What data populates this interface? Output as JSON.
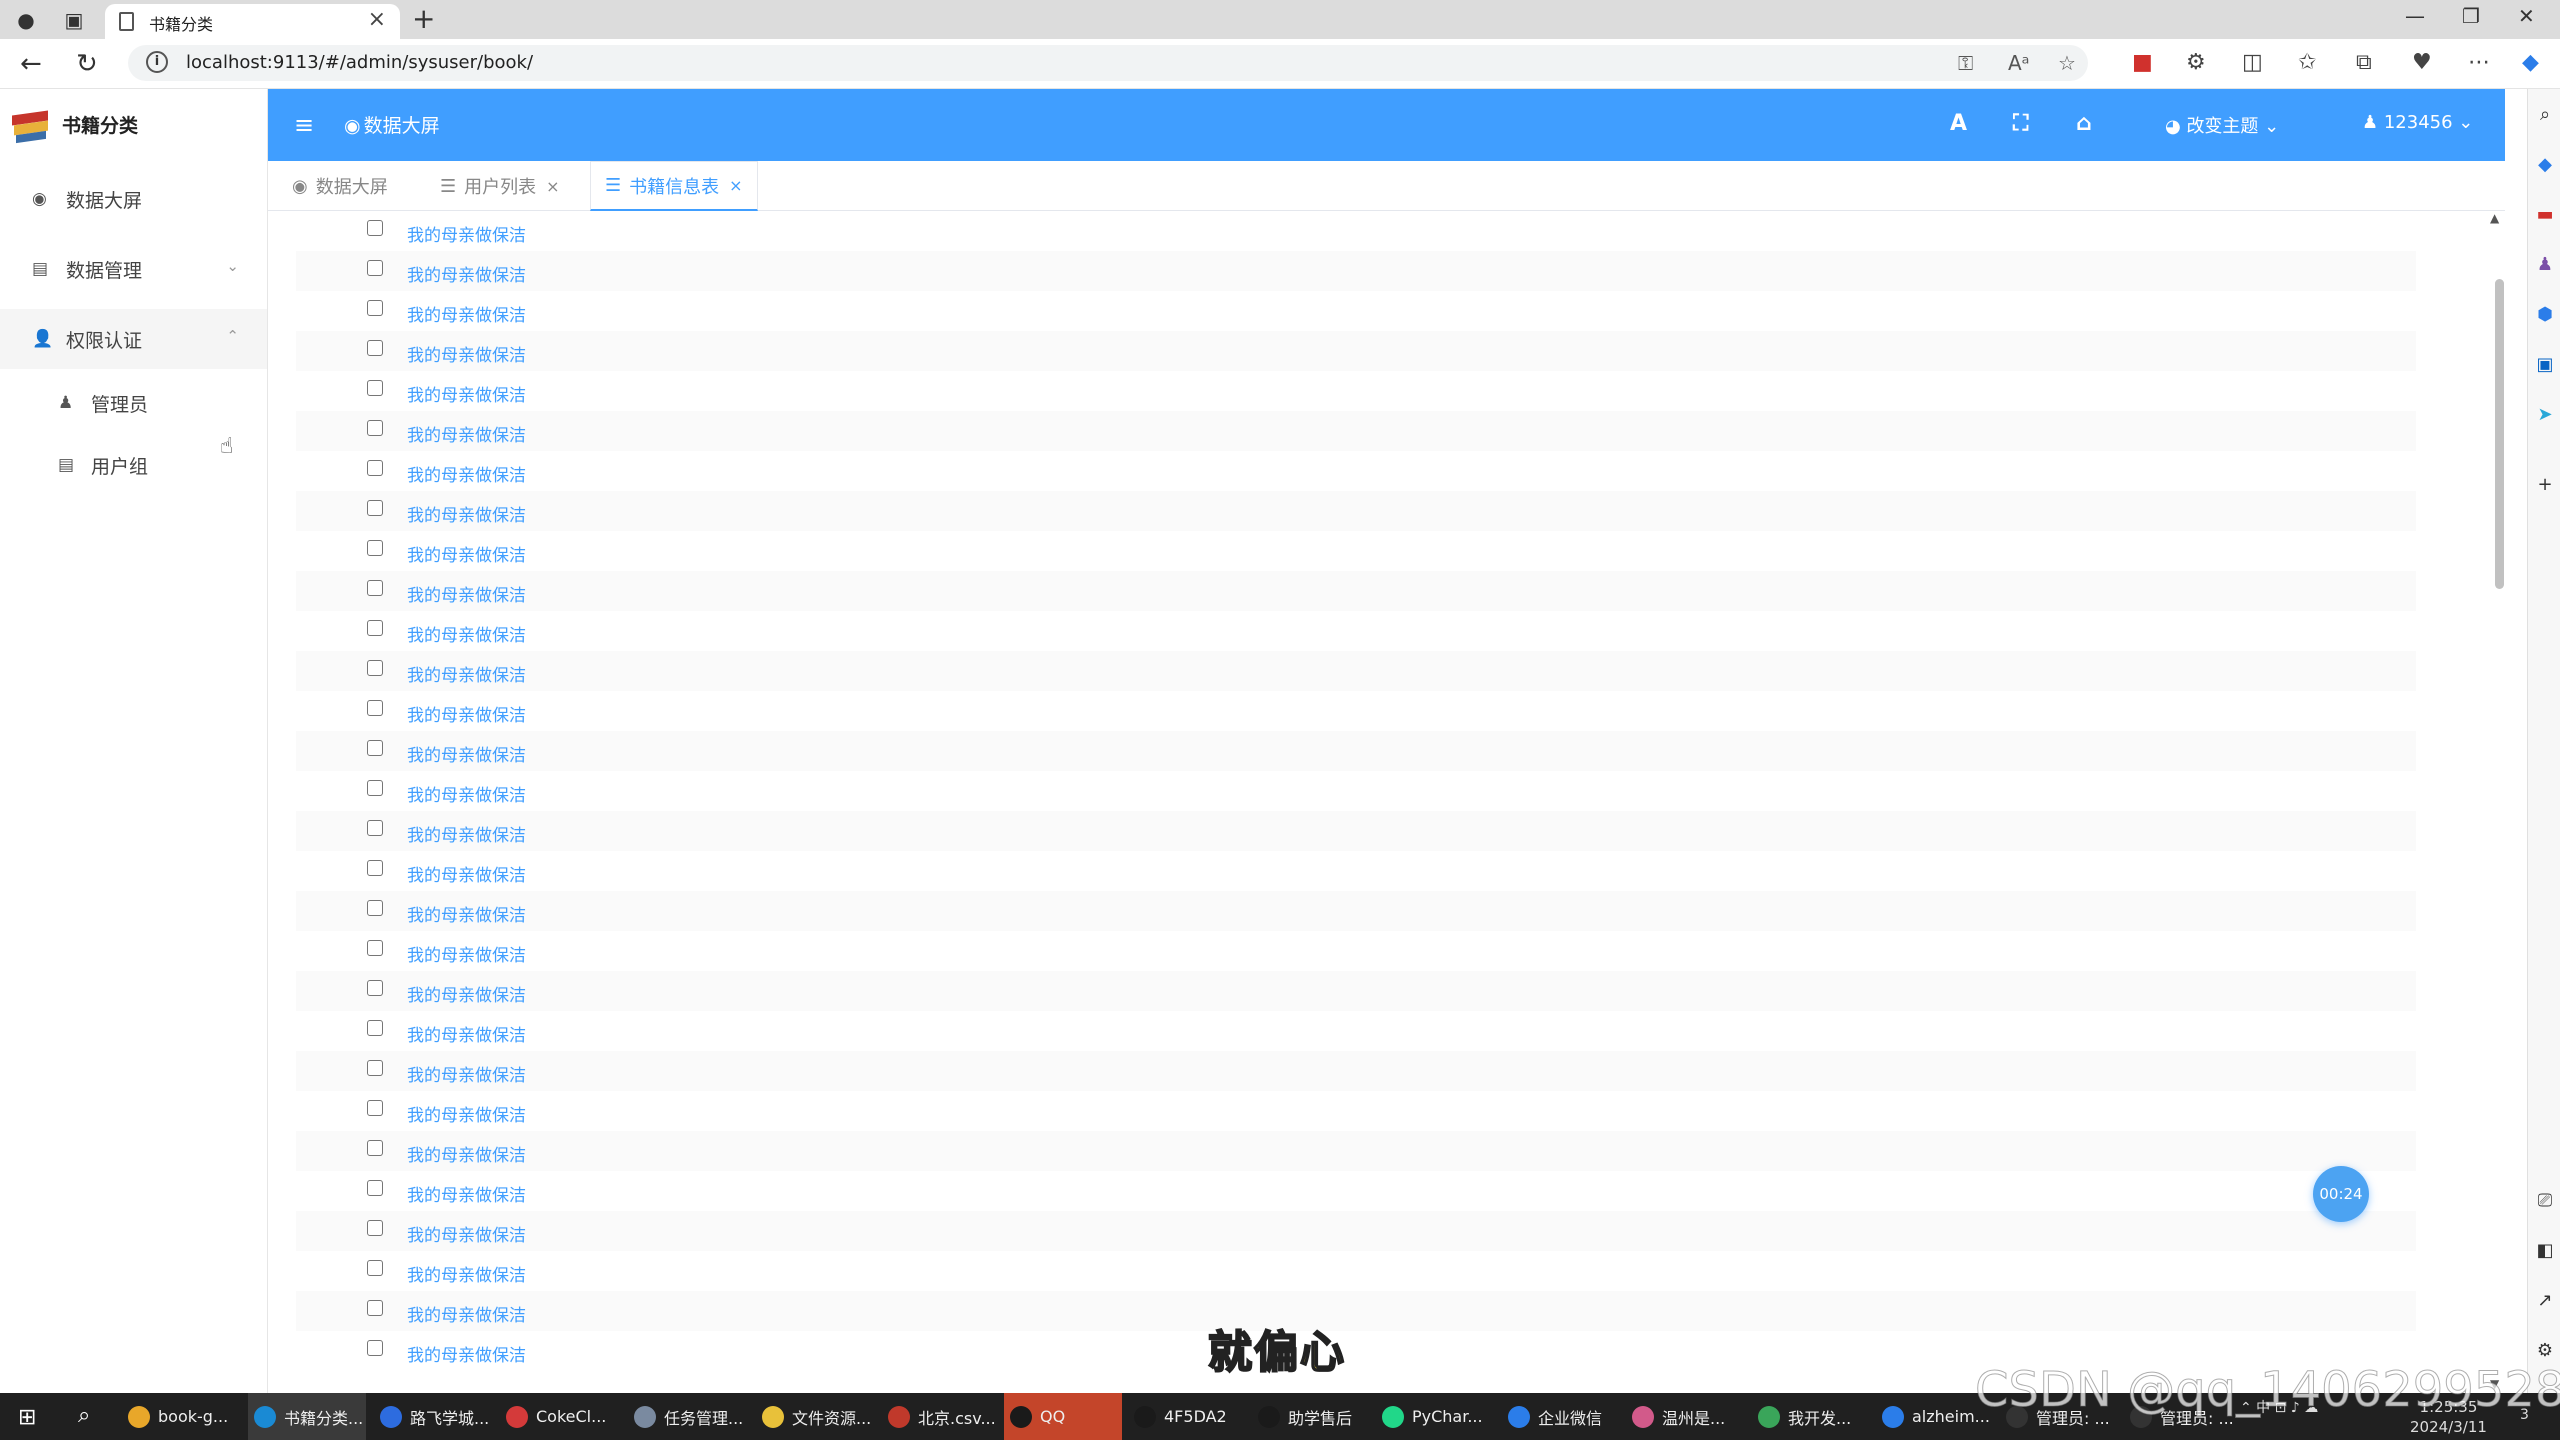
{
  "browser": {
    "tab_title": "书籍分类",
    "tab_close": "×",
    "new_tab": "+",
    "url": "localhost:9113/#/admin/sysuser/book/"
  },
  "app": {
    "title": "书籍分类",
    "menu": [
      {
        "label": "数据大屏",
        "icon": "eye-icon"
      },
      {
        "label": "数据管理",
        "icon": "table-icon"
      },
      {
        "label": "权限认证",
        "icon": "user-cog-icon"
      }
    ],
    "submenu": [
      {
        "label": "管理员",
        "icon": "user-icon"
      },
      {
        "label": "用户组",
        "icon": "table-icon"
      }
    ],
    "header": {
      "title": "数据大屏",
      "theme_label": "改变主题",
      "user_label": "123456"
    },
    "tabs": [
      {
        "label": "数据大屏",
        "icon": "eye-icon"
      },
      {
        "label": "用户列表",
        "icon": "list-icon",
        "closable": true
      },
      {
        "label": "书籍信息表",
        "icon": "list-icon",
        "closable": true,
        "active": true
      }
    ],
    "tab_close": "×",
    "rows": [
      "我的母亲做保洁",
      "我的母亲做保洁",
      "我的母亲做保洁",
      "我的母亲做保洁",
      "我的母亲做保洁",
      "我的母亲做保洁",
      "我的母亲做保洁",
      "我的母亲做保洁",
      "我的母亲做保洁",
      "我的母亲做保洁",
      "我的母亲做保洁",
      "我的母亲做保洁",
      "我的母亲做保洁",
      "我的母亲做保洁",
      "我的母亲做保洁",
      "我的母亲做保洁",
      "我的母亲做保洁",
      "我的母亲做保洁",
      "我的母亲做保洁",
      "我的母亲做保洁",
      "我的母亲做保洁",
      "我的母亲做保洁",
      "我的母亲做保洁",
      "我的母亲做保洁",
      "我的母亲做保洁",
      "我的母亲做保洁",
      "我的母亲做保洁",
      "我的母亲做保洁",
      "我的母亲做保洁"
    ],
    "timer": "00:24",
    "subtitle": "就偏心"
  },
  "taskbar": {
    "apps": [
      {
        "label": "book-g...",
        "color": "#e8a72a"
      },
      {
        "label": "书籍分类...",
        "color": "#1a8ad4",
        "active": true
      },
      {
        "label": "路飞学城...",
        "color": "#2d6cdf"
      },
      {
        "label": "CokeCl...",
        "color": "#d43a3a"
      },
      {
        "label": "任务管理...",
        "color": "#7a8aa0"
      },
      {
        "label": "文件资源...",
        "color": "#e8c13a"
      },
      {
        "label": "北京.csv...",
        "color": "#c0392b"
      },
      {
        "label": "QQ",
        "color": "#1a1a1a",
        "qq": true
      },
      {
        "label": "4F5DA2",
        "color": "#1a1a1a"
      },
      {
        "label": "助学售后",
        "color": "#1a1a1a"
      },
      {
        "label": "PyChar...",
        "color": "#21d789"
      },
      {
        "label": "企业微信",
        "color": "#2b7de9"
      },
      {
        "label": "温州是...",
        "color": "#d25a8a"
      },
      {
        "label": "我开发...",
        "color": "#3aa55a"
      },
      {
        "label": "alzheim...",
        "color": "#2b7de9"
      },
      {
        "label": "管理员: ...",
        "color": "#333333"
      },
      {
        "label": "管理员: ...",
        "color": "#333333"
      }
    ],
    "clock_time": "1:25:35",
    "clock_date": "2024/3/11",
    "notification_count": "3"
  },
  "watermark": "CSDN @qq_1406299528"
}
